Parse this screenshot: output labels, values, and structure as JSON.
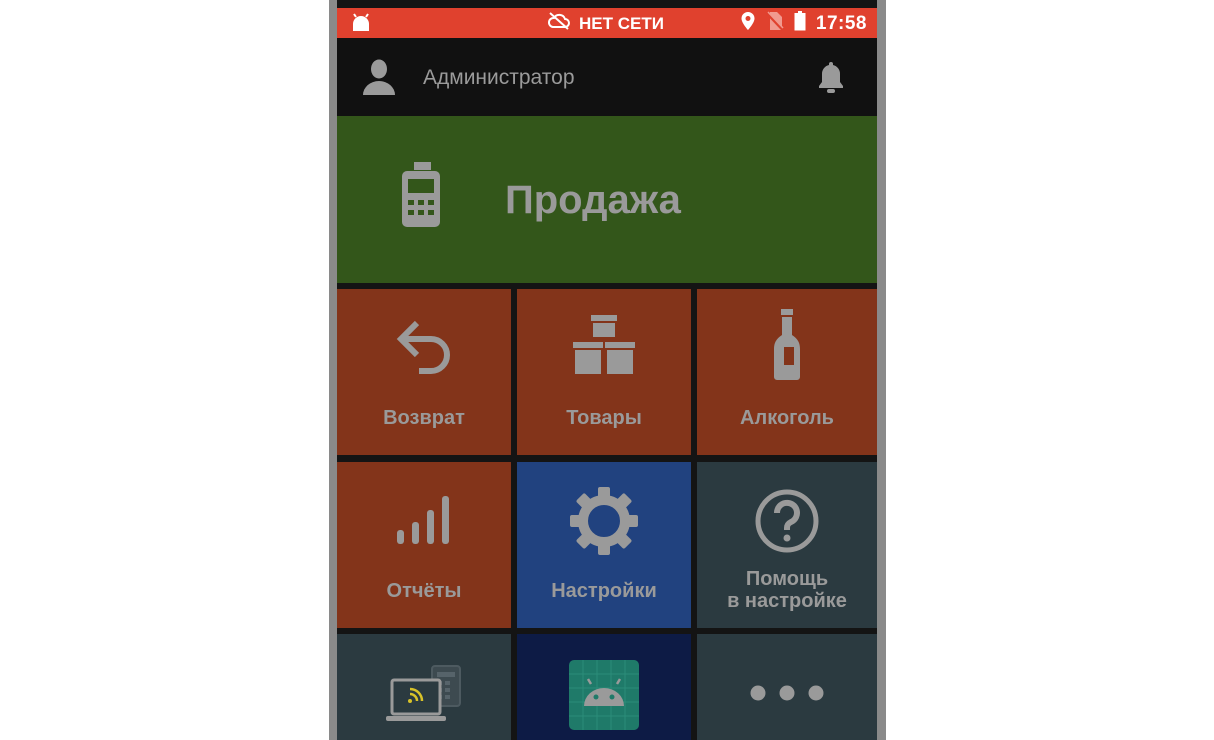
{
  "status_bar": {
    "network_text": "НЕТ СЕТИ",
    "time": "17:58",
    "icons": [
      "android-icon",
      "cloud-off-icon",
      "location-icon",
      "no-sim-icon",
      "battery-icon"
    ]
  },
  "app_bar": {
    "user_name": "Администратор",
    "icons": [
      "user-icon",
      "bell-icon"
    ]
  },
  "tiles": {
    "sale": {
      "label": "Продажа",
      "icon": "cash-register-icon",
      "color": "#33561a"
    },
    "return": {
      "label": "Возврат",
      "icon": "undo-arrow-icon",
      "color": "#83341a"
    },
    "goods": {
      "label": "Товары",
      "icon": "boxes-icon",
      "color": "#83341a"
    },
    "alcohol": {
      "label": "Алкоголь",
      "icon": "bottle-icon",
      "color": "#83341a"
    },
    "reports": {
      "label": "Отчёты",
      "icon": "signal-bars-icon",
      "color": "#83341a"
    },
    "settings": {
      "label": "Настройки",
      "icon": "gear-icon",
      "color": "#21427f"
    },
    "help": {
      "label_line1": "Помощь",
      "label_line2": "в настройке",
      "icon": "question-circle-icon",
      "color": "#2b3a40"
    },
    "devices": {
      "icon": "laptop-terminal-icon",
      "color": "#2b3a40"
    },
    "android_apps": {
      "icon": "android-app-icon",
      "color": "#0d1b45"
    },
    "more": {
      "icon": "more-dots-icon",
      "color": "#2b3a40"
    }
  },
  "colors": {
    "status_bar": "#e0412e",
    "app_bar": "#111111",
    "text_muted": "#9a9a9a"
  }
}
